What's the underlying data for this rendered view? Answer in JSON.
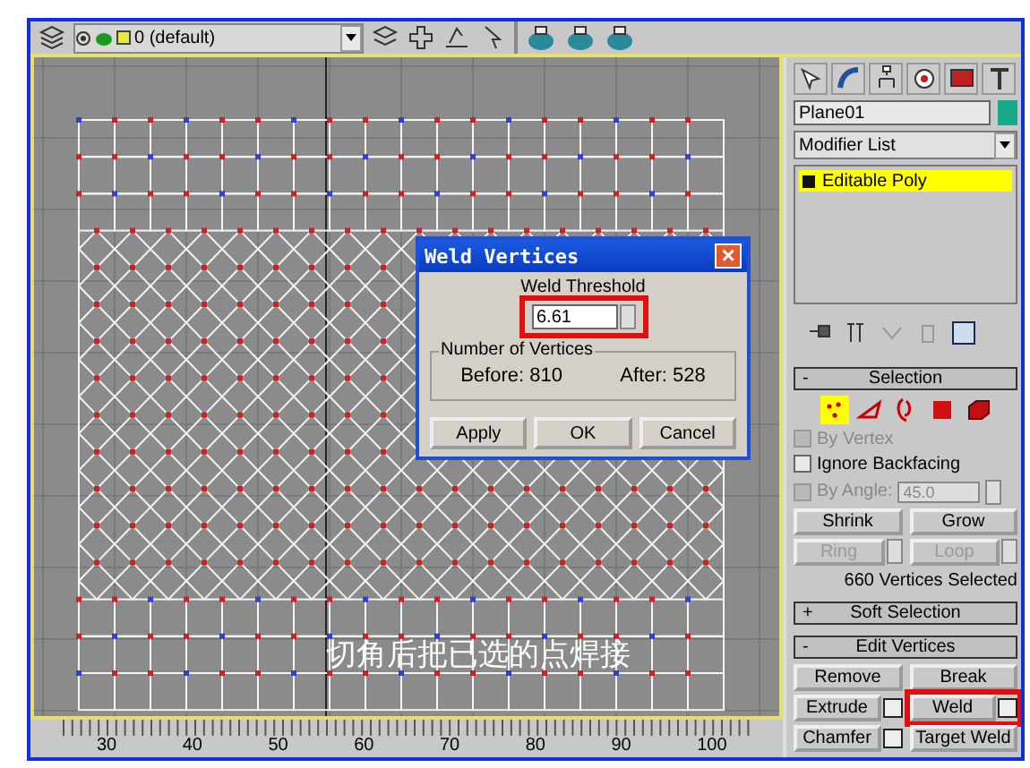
{
  "toolbar": {
    "layer_dropdown": "0 (default)"
  },
  "viewport": {
    "caption": "切角后把已选的点焊接"
  },
  "dialog": {
    "title": "Weld Vertices",
    "close": "×",
    "threshold_label": "Weld Threshold",
    "threshold_value": "6.61",
    "threshold_highlighted": true,
    "group_label": "Number of Vertices",
    "before": "Before: 810",
    "after": "After: 528",
    "buttons": [
      "Apply",
      "OK",
      "Cancel"
    ]
  },
  "ruler": {
    "labels": [
      "30",
      "40",
      "50",
      "60",
      "70",
      "80",
      "90",
      "100"
    ]
  },
  "command_panel": {
    "object_name": "Plane01",
    "modifier_list": "Modifier List",
    "stack": [
      {
        "label": "Editable Poly",
        "selected": true
      }
    ],
    "selection": {
      "sign": "-",
      "title": "Selection",
      "subobjects": [
        {
          "kind": "vertex",
          "selected": true
        },
        {
          "kind": "edge",
          "selected": false
        },
        {
          "kind": "border",
          "selected": false
        },
        {
          "kind": "polygon",
          "selected": false
        },
        {
          "kind": "element",
          "selected": false
        }
      ],
      "options": [
        {
          "label": "By Vertex",
          "checked": false,
          "disabled": true
        },
        {
          "label": "Ignore Backfacing",
          "checked": false,
          "disabled": false
        },
        {
          "label": "By Angle:",
          "checked": false,
          "disabled": true,
          "value": "45.0"
        }
      ],
      "buttons": [
        {
          "label": "Shrink",
          "disabled": false,
          "spinner": false
        },
        {
          "label": "Grow",
          "disabled": false,
          "spinner": false
        },
        {
          "label": "Ring",
          "disabled": true,
          "spinner": true
        },
        {
          "label": "Loop",
          "disabled": true,
          "spinner": true
        }
      ],
      "status": "660 Vertices Selected"
    },
    "soft_selection": {
      "sign": "+",
      "title": "Soft Selection"
    },
    "edit_vertices": {
      "sign": "-",
      "title": "Edit Vertices",
      "buttons": [
        {
          "label": "Remove",
          "settings": false,
          "highlighted": false
        },
        {
          "label": "Break",
          "settings": false,
          "highlighted": false
        },
        {
          "label": "Extrude",
          "settings": true,
          "highlighted": false
        },
        {
          "label": "Weld",
          "settings": true,
          "highlighted": true
        },
        {
          "label": "Chamfer",
          "settings": true,
          "highlighted": false
        },
        {
          "label": "Target Weld",
          "settings": false,
          "highlighted": false
        }
      ]
    }
  }
}
